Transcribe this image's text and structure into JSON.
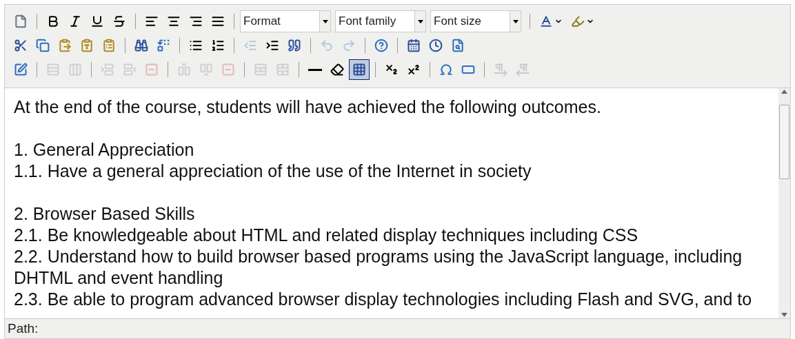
{
  "toolbars": [
    {
      "items": [
        {
          "kind": "button",
          "disabled": false,
          "selected": false
        },
        {
          "kind": "separator"
        },
        {
          "kind": "button",
          "disabled": false,
          "selected": false
        },
        {
          "kind": "button",
          "disabled": false,
          "selected": false
        },
        {
          "kind": "button",
          "disabled": false,
          "selected": false
        },
        {
          "kind": "button",
          "disabled": false,
          "selected": false
        },
        {
          "kind": "separator"
        },
        {
          "kind": "button",
          "disabled": false,
          "selected": false
        },
        {
          "kind": "button",
          "disabled": false,
          "selected": false
        },
        {
          "kind": "button",
          "disabled": false,
          "selected": false
        },
        {
          "kind": "button",
          "disabled": false,
          "selected": false
        },
        {
          "kind": "separator"
        },
        {
          "kind": "select",
          "label": "Format"
        },
        {
          "kind": "select",
          "label": "Font family"
        },
        {
          "kind": "select",
          "label": "Font size"
        },
        {
          "kind": "separator"
        },
        {
          "kind": "split",
          "disabled": false,
          "selected": false
        },
        {
          "kind": "split",
          "disabled": false,
          "selected": false
        }
      ]
    },
    {
      "items": [
        {
          "kind": "button",
          "disabled": false,
          "selected": false
        },
        {
          "kind": "button",
          "disabled": false,
          "selected": false
        },
        {
          "kind": "button",
          "disabled": false,
          "selected": false
        },
        {
          "kind": "button",
          "disabled": false,
          "selected": false
        },
        {
          "kind": "button",
          "disabled": false,
          "selected": false
        },
        {
          "kind": "separator"
        },
        {
          "kind": "button",
          "disabled": false,
          "selected": false
        },
        {
          "kind": "button",
          "disabled": false,
          "selected": false
        },
        {
          "kind": "separator"
        },
        {
          "kind": "button",
          "disabled": false,
          "selected": false
        },
        {
          "kind": "button",
          "disabled": false,
          "selected": false
        },
        {
          "kind": "separator"
        },
        {
          "kind": "button",
          "disabled": true,
          "selected": false
        },
        {
          "kind": "button",
          "disabled": false,
          "selected": false
        },
        {
          "kind": "button",
          "disabled": false,
          "selected": false
        },
        {
          "kind": "separator"
        },
        {
          "kind": "button",
          "disabled": true,
          "selected": false
        },
        {
          "kind": "button",
          "disabled": true,
          "selected": false
        },
        {
          "kind": "separator"
        },
        {
          "kind": "button",
          "disabled": false,
          "selected": false
        },
        {
          "kind": "separator"
        },
        {
          "kind": "button",
          "disabled": false,
          "selected": false
        },
        {
          "kind": "button",
          "disabled": false,
          "selected": false
        },
        {
          "kind": "button",
          "disabled": false,
          "selected": false
        }
      ]
    },
    {
      "items": [
        {
          "kind": "button",
          "disabled": false,
          "selected": false
        },
        {
          "kind": "separator"
        },
        {
          "kind": "button",
          "disabled": true,
          "selected": false
        },
        {
          "kind": "button",
          "disabled": true,
          "selected": false
        },
        {
          "kind": "separator"
        },
        {
          "kind": "button",
          "disabled": true,
          "selected": false
        },
        {
          "kind": "button",
          "disabled": true,
          "selected": false
        },
        {
          "kind": "button",
          "disabled": true,
          "selected": false
        },
        {
          "kind": "separator"
        },
        {
          "kind": "button",
          "disabled": true,
          "selected": false
        },
        {
          "kind": "button",
          "disabled": true,
          "selected": false
        },
        {
          "kind": "button",
          "disabled": true,
          "selected": false
        },
        {
          "kind": "separator"
        },
        {
          "kind": "button",
          "disabled": true,
          "selected": false
        },
        {
          "kind": "button",
          "disabled": true,
          "selected": false
        },
        {
          "kind": "separator"
        },
        {
          "kind": "button",
          "disabled": false,
          "selected": false
        },
        {
          "kind": "button",
          "disabled": false,
          "selected": false
        },
        {
          "kind": "button",
          "disabled": false,
          "selected": true
        },
        {
          "kind": "separator"
        },
        {
          "kind": "button",
          "disabled": false,
          "selected": false
        },
        {
          "kind": "button",
          "disabled": false,
          "selected": false
        },
        {
          "kind": "separator"
        },
        {
          "kind": "button",
          "disabled": false,
          "selected": false
        },
        {
          "kind": "button",
          "disabled": false,
          "selected": false
        },
        {
          "kind": "separator"
        },
        {
          "kind": "button",
          "disabled": true,
          "selected": false
        },
        {
          "kind": "button",
          "disabled": true,
          "selected": false
        }
      ]
    }
  ],
  "content": [
    [
      "At the end of the course, students will have achieved the following outcomes."
    ],
    [
      "1. General Appreciation",
      "1.1. Have a general appreciation of the use of the Internet in society"
    ],
    [
      "2. Browser Based Skills",
      "2.1. Be knowledgeable about HTML and related display techniques including CSS",
      "2.2. Understand how to build browser based programs using the JavaScript language, including DHTML and event handling",
      "2.3. Be able to program advanced browser display technologies including Flash and SVG, and to"
    ]
  ],
  "status_bar": {
    "label": "Path:"
  }
}
